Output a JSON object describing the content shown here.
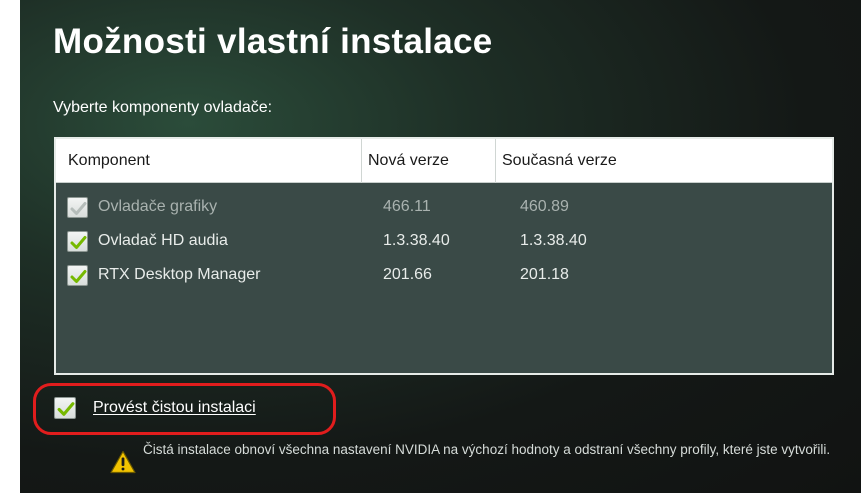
{
  "title": "Možnosti vlastní instalace",
  "subtitle": "Vyberte komponenty ovladače:",
  "table": {
    "headers": [
      "Komponent",
      "Nová verze",
      "Současná verze"
    ],
    "rows": [
      {
        "name": "Ovladače grafiky",
        "new_version": "466.11",
        "current_version": "460.89",
        "checked": true,
        "disabled": true
      },
      {
        "name": "Ovladač HD audia",
        "new_version": "1.3.38.40",
        "current_version": "1.3.38.40",
        "checked": true,
        "disabled": false
      },
      {
        "name": "RTX Desktop Manager",
        "new_version": "201.66",
        "current_version": "201.18",
        "checked": true,
        "disabled": false
      }
    ]
  },
  "clean_install": {
    "label": "Provést čistou instalaci",
    "checked": true,
    "highlight_color": "#e11d1d"
  },
  "warning": {
    "icon": "warning-triangle-icon",
    "text": "Čistá instalace obnoví všechna nastavení NVIDIA na výchozí hodnoty a odstraní všechny profily, které jste vytvořili."
  },
  "colors": {
    "check_enabled": "#76b900",
    "check_disabled": "#b5bdba",
    "panel_bg": "#3a4a47"
  }
}
